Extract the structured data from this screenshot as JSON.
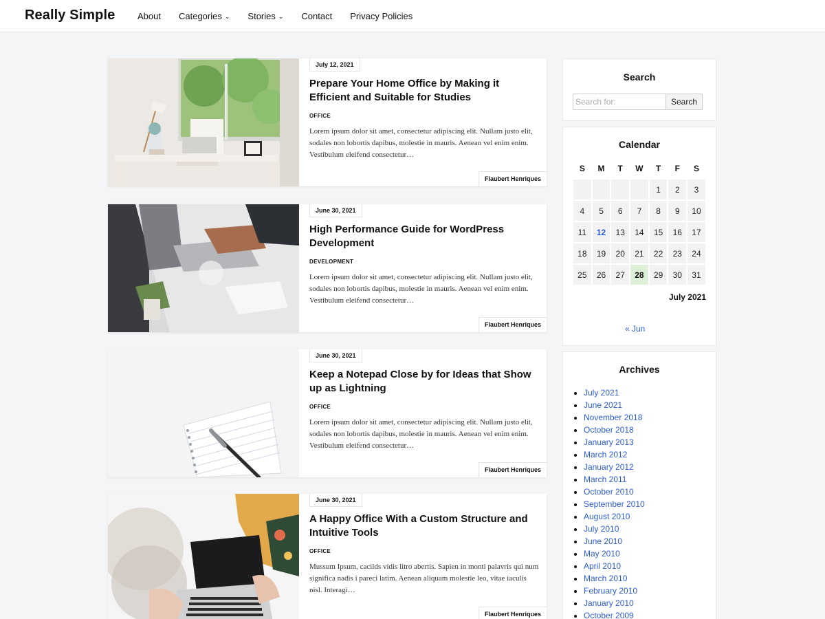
{
  "site": {
    "title": "Really Simple"
  },
  "nav": {
    "items": [
      {
        "label": "About",
        "has_dropdown": false
      },
      {
        "label": "Categories",
        "has_dropdown": true
      },
      {
        "label": "Stories",
        "has_dropdown": true
      },
      {
        "label": "Contact",
        "has_dropdown": false
      },
      {
        "label": "Privacy Policies",
        "has_dropdown": false
      }
    ],
    "dropdown_icon": "chevron-down-icon"
  },
  "posts": [
    {
      "date": "July 12, 2021",
      "title": "Prepare Your Home Office by Making it Efficient and Suitable for Studies",
      "category": "OFFICE",
      "excerpt": "Lorem ipsum dolor sit amet, consectetur adipiscing elit. Nullam justo elit, sodales non lobortis dapibus, molestie in mauris. Aenean vel enim enim. Vestibulum eleifend consectetur…",
      "author": "Flaubert Henriques"
    },
    {
      "date": "June 30, 2021",
      "title": "High Performance Guide for WordPress Development",
      "category": "DEVELOPMENT",
      "excerpt": "Lorem ipsum dolor sit amet, consectetur adipiscing elit. Nullam justo elit, sodales non lobortis dapibus, molestie in mauris. Aenean vel enim enim. Vestibulum eleifend consectetur…",
      "author": "Flaubert Henriques"
    },
    {
      "date": "June 30, 2021",
      "title": "Keep a Notepad Close by for Ideas that Show up as Lightning",
      "category": "OFFICE",
      "excerpt": "Lorem ipsum dolor sit amet, consectetur adipiscing elit. Nullam justo elit, sodales non lobortis dapibus, molestie in mauris. Aenean vel enim enim. Vestibulum eleifend consectetur…",
      "author": "Flaubert Henriques"
    },
    {
      "date": "June 30, 2021",
      "title": "A Happy Office With a Custom Structure and Intuitive Tools",
      "category": "OFFICE",
      "excerpt": "Mussum Ipsum, cacilds vidis litro abertis. Sapien in monti palavris qui num significa nadis i pareci latim. Aenean aliquam molestie leo, vitae iaculis nisl. Interagi…",
      "author": "Flaubert Henriques"
    }
  ],
  "search_widget": {
    "title": "Search",
    "placeholder": "Search for:",
    "button_label": "Search"
  },
  "calendar_widget": {
    "title": "Calendar",
    "weekdays": [
      "S",
      "M",
      "T",
      "W",
      "T",
      "F",
      "S"
    ],
    "weeks": [
      [
        "",
        "",
        "",
        "",
        "1",
        "2",
        "3"
      ],
      [
        "4",
        "5",
        "6",
        "7",
        "8",
        "9",
        "10"
      ],
      [
        "11",
        "12",
        "13",
        "14",
        "15",
        "16",
        "17"
      ],
      [
        "18",
        "19",
        "20",
        "21",
        "22",
        "23",
        "24"
      ],
      [
        "25",
        "26",
        "27",
        "28",
        "29",
        "30",
        "31"
      ]
    ],
    "linked_day": "12",
    "today": "28",
    "caption": "July 2021",
    "prev_link": "« Jun",
    "accent_color": "#2a5bd7",
    "today_color": "#dff0d8"
  },
  "archives_widget": {
    "title": "Archives",
    "items": [
      "July 2021",
      "June 2021",
      "November 2018",
      "October 2018",
      "January 2013",
      "March 2012",
      "January 2012",
      "March 2011",
      "October 2010",
      "September 2010",
      "August 2010",
      "July 2010",
      "June 2010",
      "May 2010",
      "April 2010",
      "March 2010",
      "February 2010",
      "January 2010",
      "October 2009"
    ]
  }
}
